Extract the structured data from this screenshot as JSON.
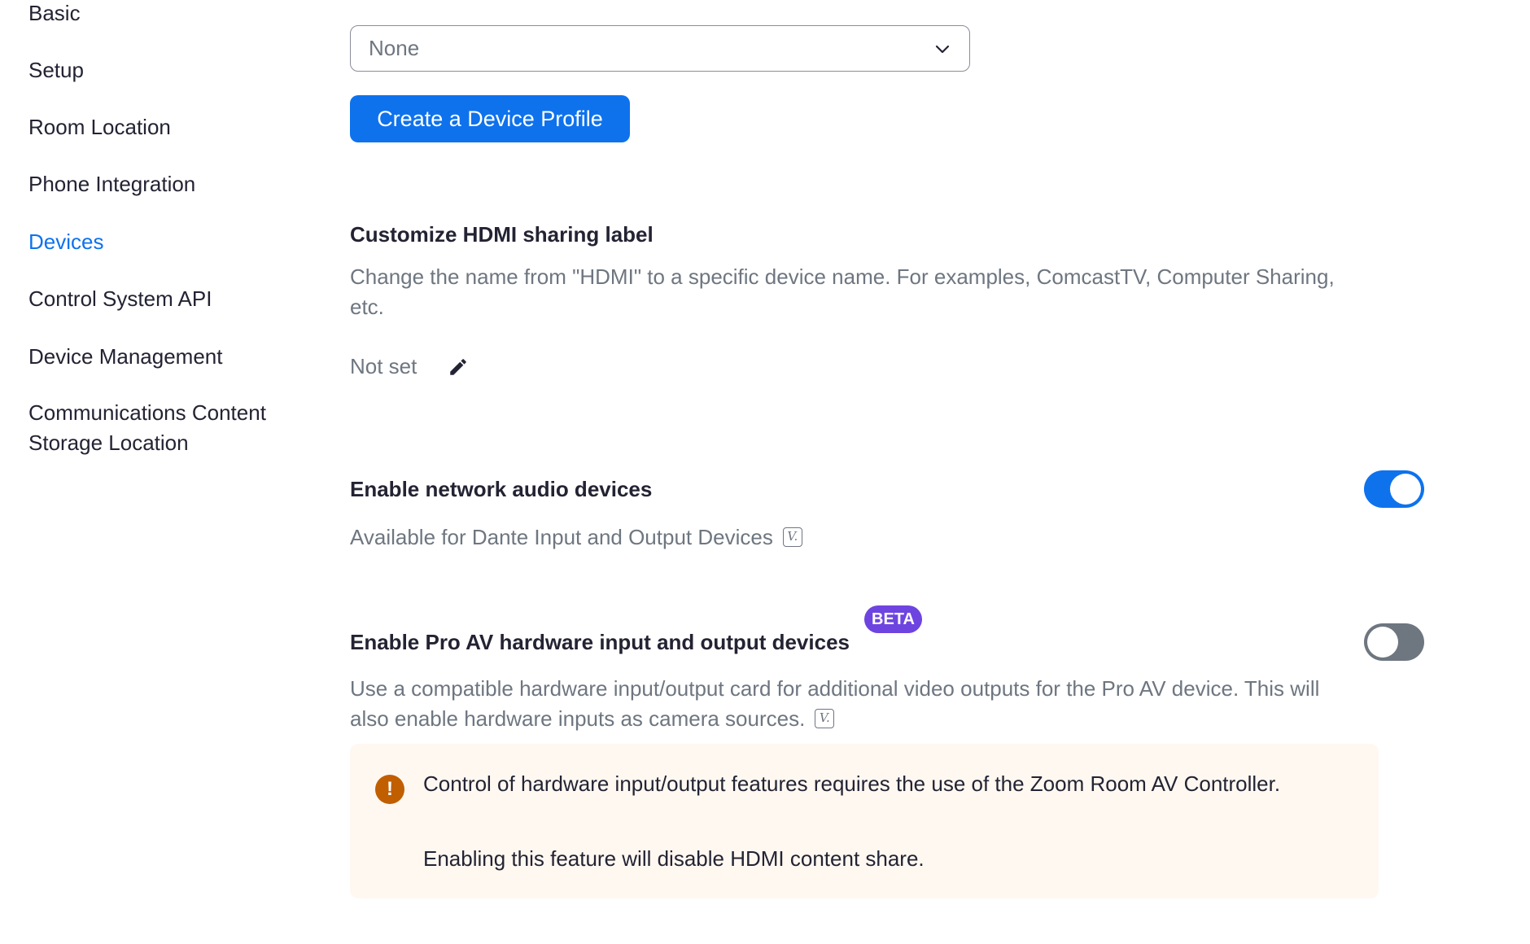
{
  "sidebar": {
    "items": [
      {
        "label": "Basic"
      },
      {
        "label": "Setup"
      },
      {
        "label": "Room Location"
      },
      {
        "label": "Phone Integration"
      },
      {
        "label": "Devices",
        "active": true
      },
      {
        "label": "Control System API"
      },
      {
        "label": "Device Management"
      },
      {
        "label": "Communications Content Storage Location"
      }
    ]
  },
  "device_profile": {
    "select_value": "None",
    "create_button_label": "Create a Device Profile"
  },
  "hdmi_label": {
    "title": "Customize HDMI sharing label",
    "description": "Change the name from \"HDMI\" to a specific device name. For examples, ComcastTV, Computer Sharing, etc.",
    "value": "Not set"
  },
  "network_audio": {
    "title": "Enable network audio devices",
    "description": "Available for Dante Input and Output Devices",
    "enabled": true
  },
  "pro_av": {
    "title": "Enable Pro AV hardware input and output devices",
    "badge": "BETA",
    "description": "Use a compatible hardware input/output card for additional video outputs for the Pro AV device. This will also enable hardware inputs as camera sources.",
    "enabled": false
  },
  "alert": {
    "icon_text": "!",
    "message": "Control of hardware input/output features requires the use of the Zoom Room AV Controller.",
    "message2": "Enabling this feature will disable HDMI content share."
  },
  "version_icon": "V.",
  "colors": {
    "accent": "#0e72ed",
    "beta": "#6e44e0",
    "warning": "#c05e00",
    "alert_bg": "#fff8f1"
  }
}
